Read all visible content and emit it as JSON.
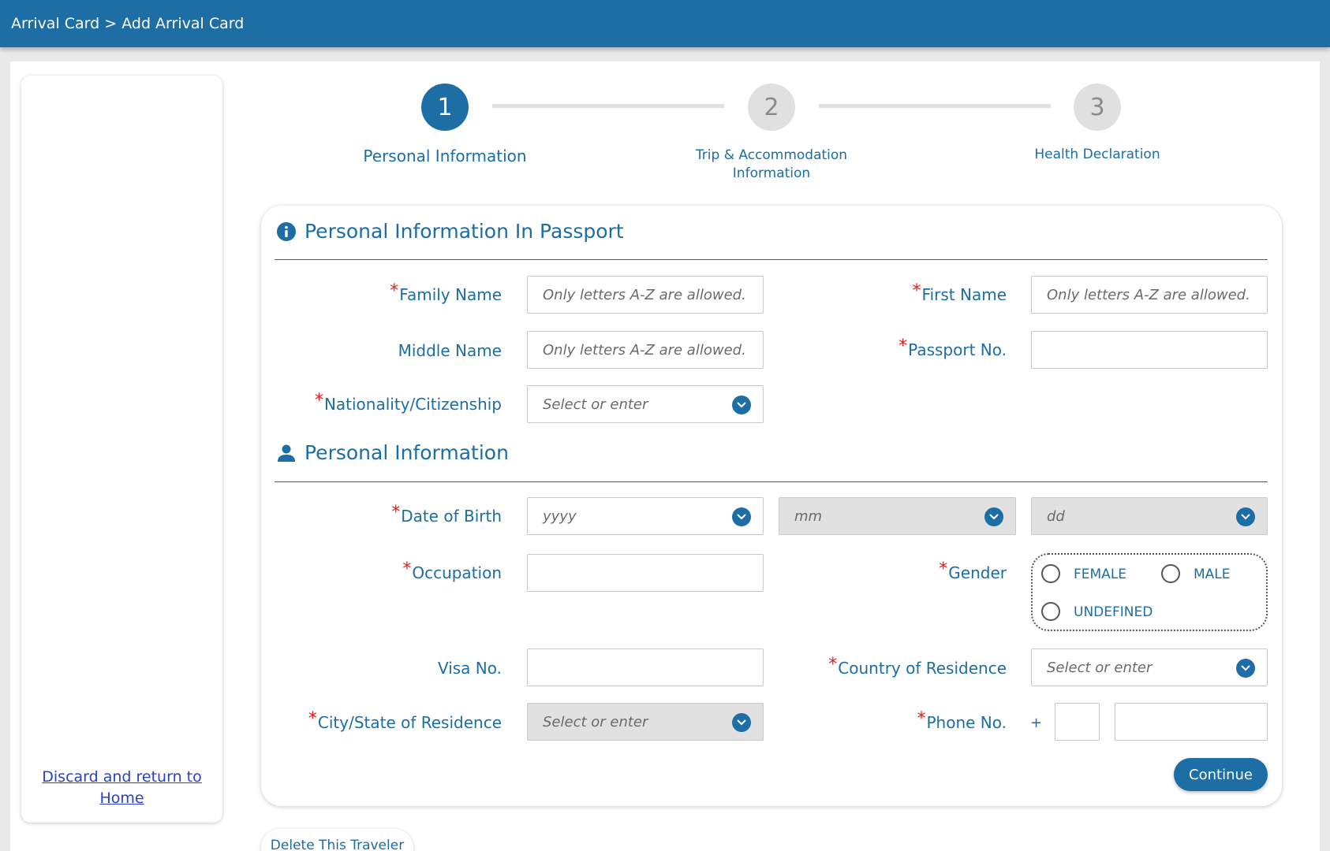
{
  "header": {
    "breadcrumb": "Arrival Card > Add Arrival Card"
  },
  "sidebar": {
    "discard_link_line1": "Discard and return to",
    "discard_link_line2": "Home"
  },
  "stepper": {
    "steps": [
      {
        "number": "1",
        "label": "Personal Information",
        "state": "active"
      },
      {
        "number": "2",
        "label_line1": "Trip & Accommodation",
        "label_line2": "Information",
        "state": "inactive"
      },
      {
        "number": "3",
        "label": "Health Declaration",
        "state": "inactive"
      }
    ]
  },
  "passport_section": {
    "title": "Personal Information In Passport",
    "icon": "info-icon",
    "family_name": {
      "label": "Family Name",
      "required": "*",
      "placeholder": "Only letters A-Z are allowed."
    },
    "first_name": {
      "label": "First Name",
      "required": "*",
      "placeholder": "Only letters A-Z are allowed."
    },
    "middle_name": {
      "label": "Middle Name",
      "placeholder": "Only letters A-Z are allowed."
    },
    "passport_no": {
      "label": "Passport No.",
      "required": "*",
      "placeholder": ""
    },
    "nationality": {
      "label": "Nationality/Citizenship",
      "required": "*",
      "placeholder": "Select or enter"
    }
  },
  "personal_section": {
    "title": "Personal Information",
    "icon": "person-icon",
    "dob": {
      "label": "Date of Birth",
      "required": "*",
      "year_placeholder": "yyyy",
      "month_placeholder": "mm",
      "day_placeholder": "dd"
    },
    "occupation": {
      "label": "Occupation",
      "required": "*",
      "placeholder": ""
    },
    "gender": {
      "label": "Gender",
      "required": "*",
      "options": [
        "FEMALE",
        "MALE",
        "UNDEFINED"
      ]
    },
    "visa_no": {
      "label": "Visa No.",
      "placeholder": ""
    },
    "country_residence": {
      "label": "Country of Residence",
      "required": "*",
      "placeholder": "Select or enter"
    },
    "city_residence": {
      "label": "City/State of Residence",
      "required": "*",
      "placeholder": "Select or enter"
    },
    "phone": {
      "label": "Phone No.",
      "required": "*",
      "prefix": "+"
    }
  },
  "actions": {
    "continue_label": "Continue",
    "delete_label": "Delete This Traveler"
  },
  "colors": {
    "brand": "#1c6ea4",
    "required": "#e31b1b",
    "link": "#2a40c8"
  }
}
